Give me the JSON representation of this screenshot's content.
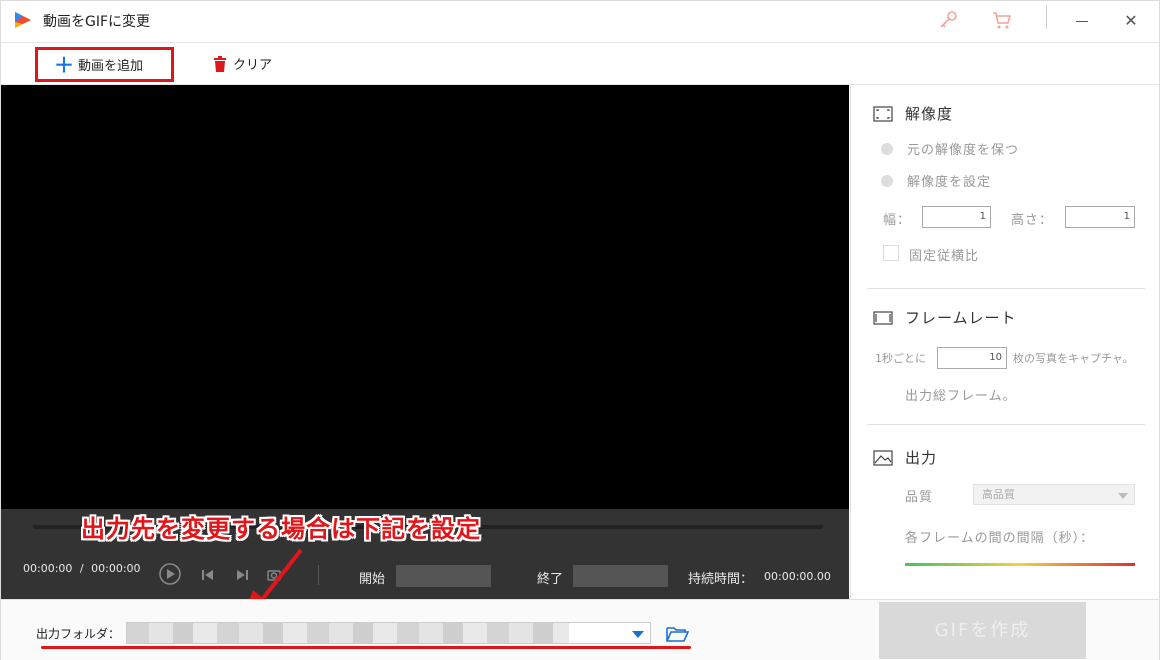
{
  "window": {
    "title": "動画をGIFに変更"
  },
  "toolbar": {
    "add_label": "動画を追加",
    "clear_label": "クリア"
  },
  "player": {
    "time": "00:00:00",
    "time_sep": "/",
    "time_total": "00:00:00",
    "start_label": "開始",
    "end_label": "終了",
    "duration_label": "持続時間：",
    "duration_value": "00:00:00.00"
  },
  "annotation": {
    "text": "出力先を変更する場合は下記を設定",
    "color": "#e0161b"
  },
  "resolution": {
    "title": "解像度",
    "keep_label": "元の解像度を保つ",
    "set_label": "解像度を設定",
    "width_label": "幅：",
    "width_value": "1",
    "height_label": "高さ：",
    "height_value": "1",
    "lock_ratio_label": "固定従横比"
  },
  "framerate": {
    "title": "フレームレート",
    "per_sec_label": "1秒ごとに",
    "value": "10",
    "capture_label": "枚の写真をキャプチャ。",
    "total_label": "出力総フレーム。"
  },
  "output": {
    "title": "出力",
    "quality_label": "品質",
    "quality_value": "高品質",
    "interval_label": "各フレームの間の間隔（秒）："
  },
  "bottom": {
    "folder_label": "出力フォルダ：",
    "create_label": "GIFを作成"
  },
  "colors": {
    "accent": "#1a73e8",
    "highlight": "#d9191e"
  }
}
